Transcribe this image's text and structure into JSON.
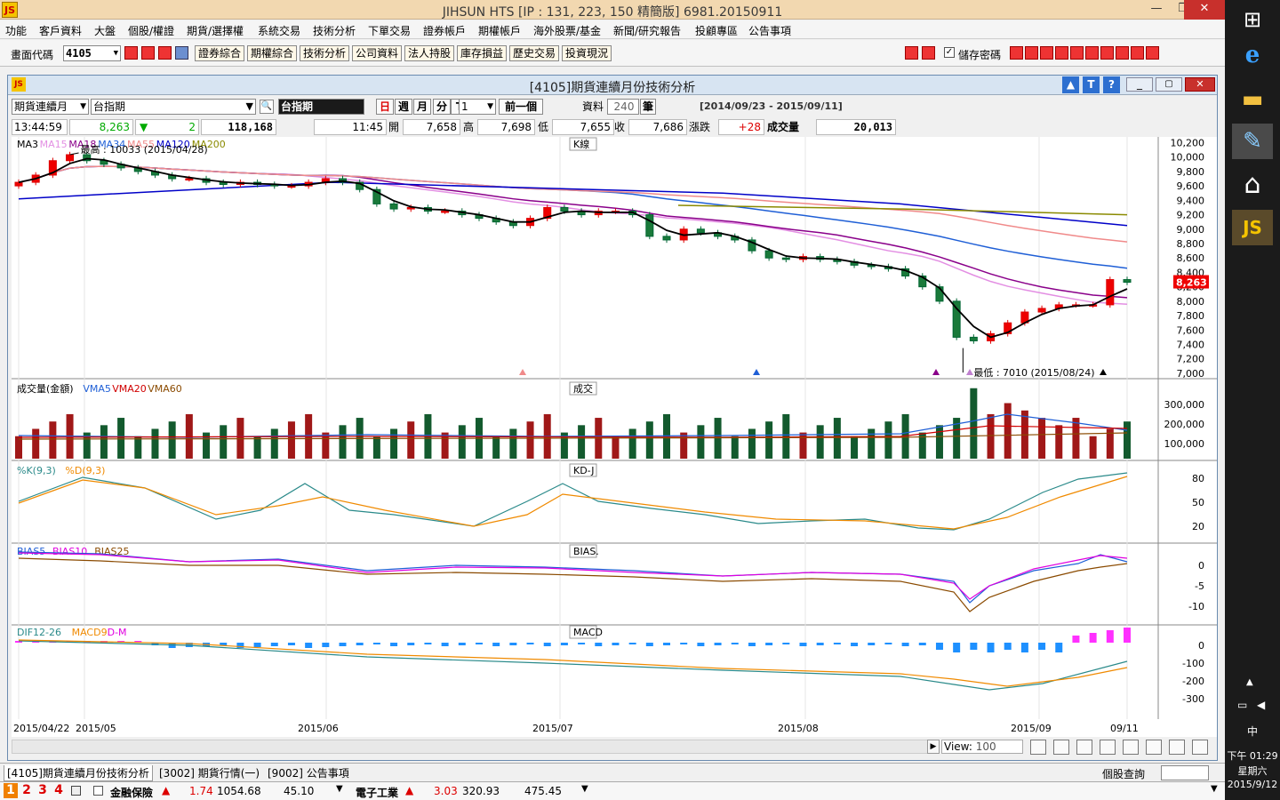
{
  "app": {
    "logo": "JS",
    "title": "JIHSUN HTS     [IP : 131, 223, 150 精簡版] 6981.20150911"
  },
  "menu": [
    "功能",
    "客戶資料",
    "大盤",
    "個股/權證",
    "期貨/選擇權",
    "系統交易",
    "技術分析",
    "下單交易",
    "證券帳戶",
    "期權帳戶",
    "海外股票/基金",
    "新聞/研究報告",
    "投顧專區",
    "公告事項"
  ],
  "toolbar": {
    "code_label": "畫面代碼",
    "code_value": "4105",
    "buttons": [
      "證券綜合",
      "期權綜合",
      "技術分析",
      "公司資料",
      "法人持股",
      "庫存損益",
      "歷史交易",
      "投資現況"
    ],
    "save_password": "儲存密碼"
  },
  "subwindow": {
    "title": "[4105]期貨連續月份技術分析",
    "product_select": "期貨連續月",
    "symbol": "台指期",
    "symbol_name": "台指期",
    "periods": [
      "日",
      "週",
      "月",
      "分",
      "T"
    ],
    "interval_value": "1",
    "prev_button": "前一個",
    "data_label": "資料",
    "data_count": "240",
    "data_unit": "筆",
    "date_range": "[2014/09/23 - 2015/09/11]"
  },
  "quote": {
    "time": "13:44:59",
    "price": "8,263",
    "change": "2",
    "volume_total": "118,168",
    "bar_time": "11:45",
    "open_label": "開",
    "open": "7,658",
    "high_label": "高",
    "high": "7,698",
    "low_label": "低",
    "low": "7,655",
    "close_label": "收",
    "close": "7,686",
    "chg_label": "漲跌",
    "chg": "+28",
    "vol_label": "成交量",
    "vol": "20,013"
  },
  "panels": {
    "k": {
      "tag": "K線",
      "legend": [
        "MA3",
        "MA15",
        "MA18",
        "MA34",
        "MA55",
        "MA120",
        "MA200"
      ],
      "legend_colors": [
        "#000000",
        "#e38fe3",
        "#8a008a",
        "#1f5fd6",
        "#f08a8a",
        "#0000c8",
        "#8a8a00"
      ],
      "high_note": "最高 : 10033 (2015/04/28)",
      "low_note": "最低 : 7010 (2015/08/24)",
      "last_label": "8,263",
      "yticks": [
        "10,200",
        "10,000",
        "9,800",
        "9,600",
        "9,400",
        "9,200",
        "9,000",
        "8,800",
        "8,600",
        "8,400",
        "8,200",
        "8,000",
        "7,800",
        "7,600",
        "7,400",
        "7,200",
        "7,000"
      ]
    },
    "vol": {
      "tag": "成交",
      "legend": [
        "成交量(金額)",
        "VMA5",
        "VMA20",
        "VMA60"
      ],
      "legend_colors": [
        "#000000",
        "#1f5fd6",
        "#d00000",
        "#8a4a00"
      ],
      "yticks": [
        "300,000",
        "200,000",
        "100,000"
      ]
    },
    "kd": {
      "tag": "KD-J",
      "legend": [
        "%K(9,3)",
        "%D(9,3)"
      ],
      "legend_colors": [
        "#2a8a8a",
        "#f08a00"
      ],
      "yticks": [
        "80",
        "50",
        "20"
      ]
    },
    "bias": {
      "tag": "BIAS.",
      "legend": [
        "BIAS5",
        "BIAS10",
        "BIAS25"
      ],
      "legend_colors": [
        "#1f5fd6",
        "#e000e0",
        "#8a4a00"
      ],
      "yticks": [
        "0",
        "-5",
        "-10"
      ]
    },
    "macd": {
      "tag": "MACD",
      "legend": [
        "DIF12-26",
        "MACD9",
        "D-M"
      ],
      "legend_colors": [
        "#2a8a8a",
        "#f08a00",
        "#e000e0"
      ],
      "yticks": [
        "0",
        "-100",
        "-200",
        "-300"
      ]
    }
  },
  "xaxis": [
    "2015/04/22",
    "2015/05",
    "2015/06",
    "2015/07",
    "2015/08",
    "2015/09",
    "09/11"
  ],
  "view": {
    "label": "View:",
    "value": "100"
  },
  "tabs": [
    "[4105]期貨連續月份技術分析",
    "[3002] 期貨行情(一)",
    "[9002] 公告事項"
  ],
  "stock_query": "個股查詢",
  "status": {
    "nums": [
      "1",
      "2",
      "3",
      "4"
    ],
    "sector1": "金融保險",
    "s1_chg": "1.74",
    "s1_idx": "1054.68",
    "s1_val": "45.10",
    "sector2": "電子工業",
    "s2_chg": "3.03",
    "s2_idx": "320.93",
    "s2_val": "475.45"
  },
  "taskbar": {
    "ime": "中",
    "time": "下午 01:29",
    "weekday": "星期六",
    "date": "2015/9/12"
  },
  "chart_data": [
    {
      "type": "candlestick",
      "title": "K線",
      "x": [
        "2015/04/22",
        "2015/05",
        "2015/06",
        "2015/07",
        "2015/08",
        "2015/09",
        "09/11"
      ],
      "ylim": [
        7000,
        10200
      ],
      "close_series": [
        9650,
        9750,
        9950,
        10033,
        9950,
        9900,
        9850,
        9800,
        9750,
        9700,
        9700,
        9650,
        9620,
        9650,
        9620,
        9600,
        9600,
        9650,
        9700,
        9650,
        9550,
        9350,
        9280,
        9300,
        9250,
        9250,
        9200,
        9150,
        9100,
        9050,
        9150,
        9300,
        9250,
        9200,
        9250,
        9250,
        9200,
        8900,
        8850,
        9000,
        8950,
        8900,
        8850,
        8700,
        8600,
        8580,
        8620,
        8580,
        8550,
        8500,
        8480,
        8450,
        8350,
        8200,
        8000,
        7500,
        7450,
        7550,
        7700,
        7850,
        7900,
        7950,
        7950,
        7950,
        8300,
        8263
      ],
      "series": [
        {
          "name": "MA3"
        },
        {
          "name": "MA15"
        },
        {
          "name": "MA18"
        },
        {
          "name": "MA34"
        },
        {
          "name": "MA55"
        },
        {
          "name": "MA120"
        },
        {
          "name": "MA200"
        }
      ],
      "annotations": [
        "最高 : 10033 (2015/04/28)",
        "最低 : 7010 (2015/08/24)"
      ],
      "last": 8263
    },
    {
      "type": "bar",
      "title": "成交",
      "ylim": [
        0,
        370000
      ],
      "series": [
        {
          "name": "成交量(金額)"
        },
        {
          "name": "VMA5"
        },
        {
          "name": "VMA20"
        },
        {
          "name": "VMA60"
        }
      ]
    },
    {
      "type": "line",
      "title": "KD-J",
      "ylim": [
        0,
        100
      ],
      "series": [
        {
          "name": "%K(9,3)"
        },
        {
          "name": "%D(9,3)"
        }
      ]
    },
    {
      "type": "line",
      "title": "BIAS.",
      "ylim": [
        -12,
        4
      ],
      "series": [
        {
          "name": "BIAS5"
        },
        {
          "name": "BIAS10"
        },
        {
          "name": "BIAS25"
        }
      ]
    },
    {
      "type": "bar",
      "title": "MACD",
      "ylim": [
        -330,
        40
      ],
      "series": [
        {
          "name": "DIF12-26"
        },
        {
          "name": "MACD9"
        },
        {
          "name": "D-M"
        }
      ]
    }
  ]
}
